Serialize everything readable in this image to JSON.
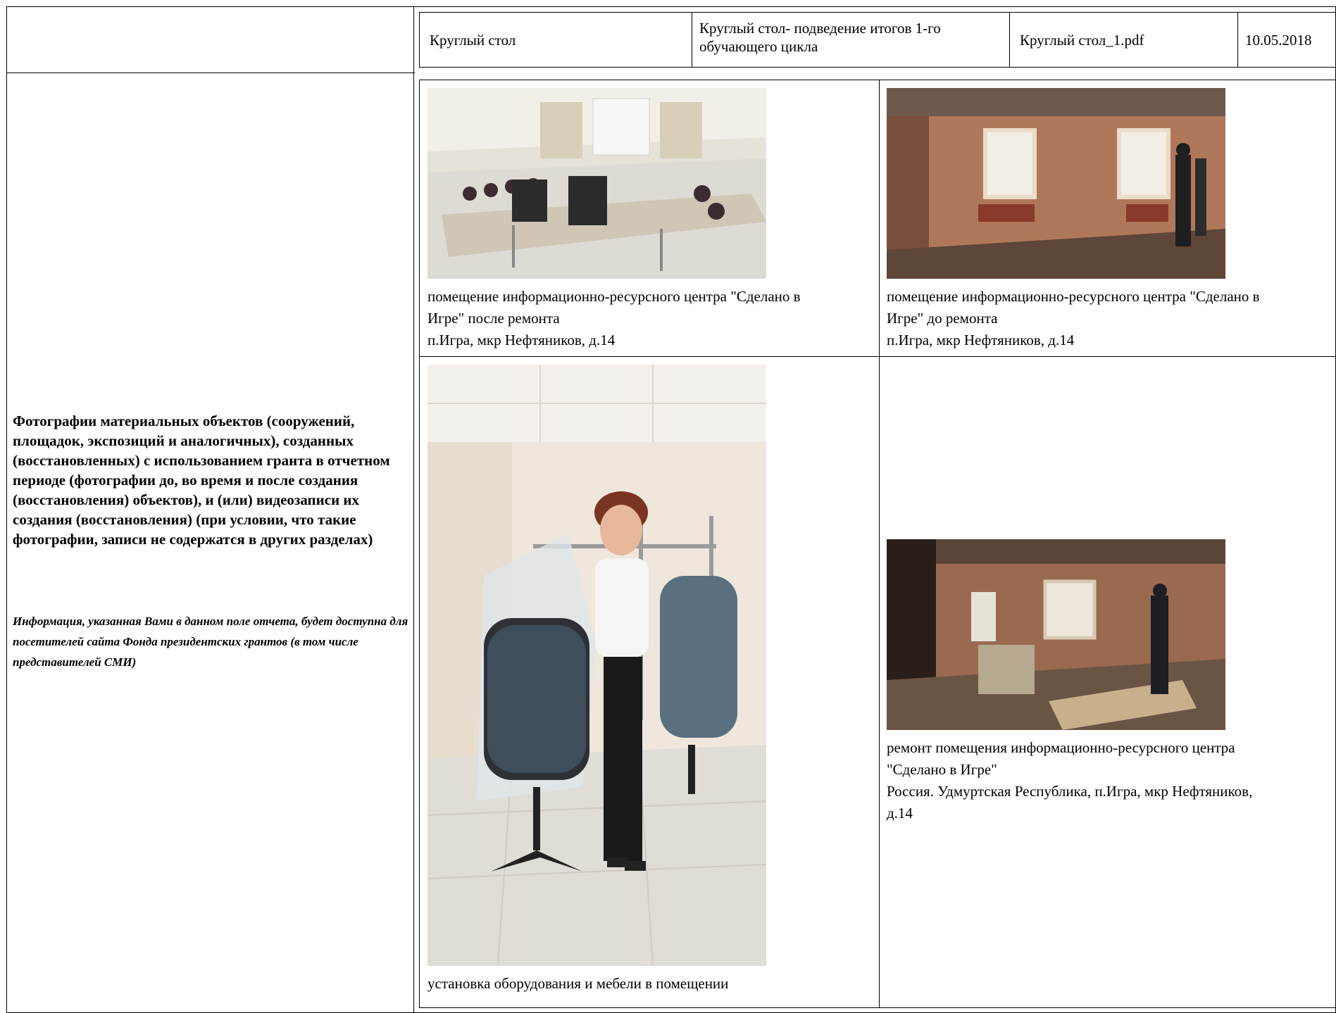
{
  "top_row": {
    "type": "Круглый стол",
    "description": "Круглый стол- подведение итогов 1-го обучающего цикла",
    "file": "Круглый стол_1.pdf",
    "date": "10.05.2018"
  },
  "section": {
    "title": "Фотографии материальных объектов (сооружений, площадок, экспозиций и аналогичных), созданных (восстановленных) с использованием гранта в отчетном периоде (фотографии до, во время и после создания (восстановления) объектов), и (или) видеозаписи их создания (восстановления) (при условии, что такие фотографии, записи не содержатся в других разделах)",
    "note": "Информация, указанная Вами в данном поле отчета, будет доступна для посетителей сайта Фонда президентских грантов (в том числе представителей СМИ)"
  },
  "photos": [
    {
      "caption_line1": "помещение информационно-ресурсного центра \"Сделано в",
      "caption_line2": "Игре\" после ремонта",
      "caption_line3": "п.Игра, мкр Нефтяников, д.14"
    },
    {
      "caption_line1": "помещение информационно-ресурсного центра \"Сделано в",
      "caption_line2": "Игре\" до ремонта",
      "caption_line3": "п.Игра, мкр Нефтяников, д.14"
    },
    {
      "caption_line1": "установка оборудования и мебели в помещении"
    },
    {
      "caption_line1": "ремонт помещения информационно-ресурсного центра",
      "caption_line2": "\"Сделано в Игре\"",
      "caption_line3": "Россия. Удмуртская Республика, п.Игра, мкр Нефтяников,",
      "caption_line4": "д.14"
    }
  ]
}
